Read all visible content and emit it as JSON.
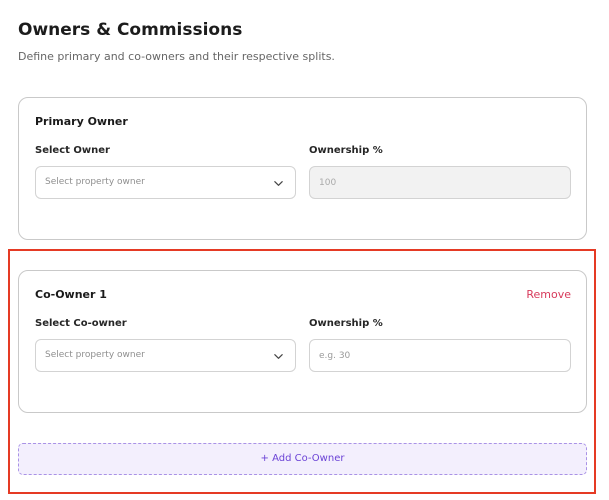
{
  "header": {
    "title": "Owners & Commissions",
    "subtitle": "Define primary and co-owners and their respective splits."
  },
  "primary_owner": {
    "heading": "Primary Owner",
    "select_label": "Select Owner",
    "select_value": "Select property owner",
    "ownership_label": "Ownership %",
    "ownership_value": "100"
  },
  "co_owner": {
    "heading": "Co-Owner 1",
    "remove_label": "Remove",
    "select_label": "Select Co-owner",
    "select_value": "Select property owner",
    "ownership_label": "Ownership %",
    "ownership_placeholder": "e.g. 30"
  },
  "add_co_owner_label": "+ Add Co-Owner",
  "colors": {
    "remove": "#d73a5b",
    "add_button_text": "#6b43d6",
    "add_button_bg": "#f3effd",
    "highlight_frame": "#e53a24"
  },
  "icons": {
    "select_chevron": "chevron-down-icon"
  }
}
